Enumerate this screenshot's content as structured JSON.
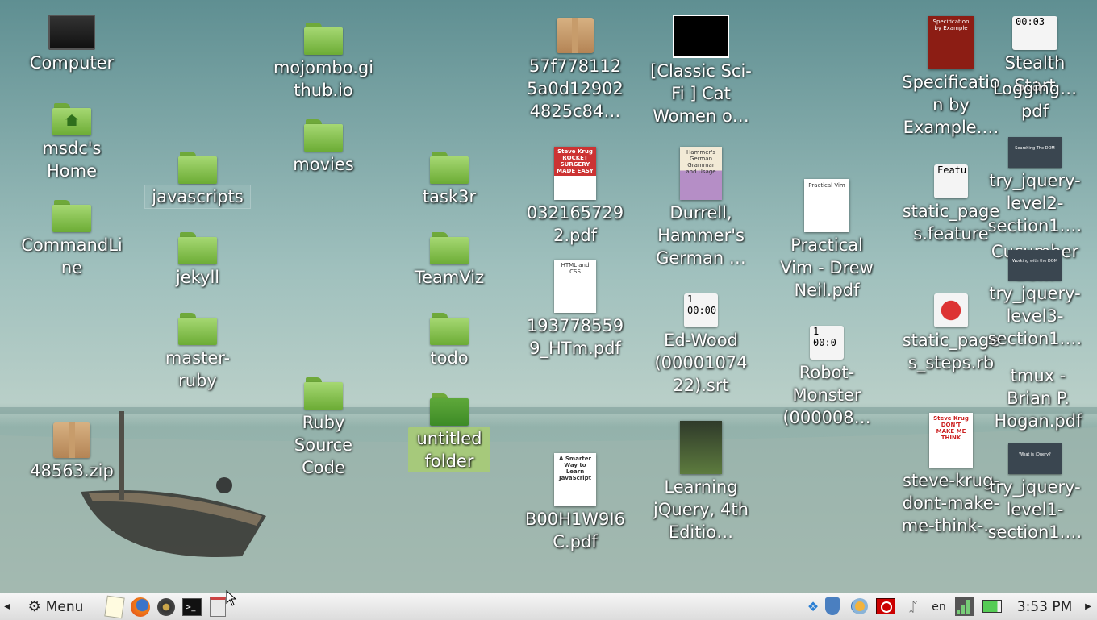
{
  "desktop": {
    "icons": {
      "computer": "Computer",
      "home": "msdc's Home",
      "commandline": "CommandLine",
      "zip48563": "48563.zip",
      "javascripts": "javascripts",
      "jekyll": "jekyll",
      "master_ruby": "master-ruby",
      "mojombo": "mojombo.github.io",
      "movies": "movies",
      "ruby_source": "Ruby Source Code",
      "task3r": "task3r",
      "teamviz": "TeamViz",
      "todo": "todo",
      "untitled": "untitled folder",
      "zip57f": "57f7781125a0d129024825c84…",
      "rocket": "0321657292.pdf",
      "html_css": "1937785599_HTm.pdf",
      "b00h": "B00H1W9I6C.pdf",
      "catwomen": "[Classic Sci-Fi ] Cat Women o…",
      "durrell": "Durrell, Hammer's German …",
      "edwood": "Ed-Wood (0000107422).srt",
      "learning_jquery": "Learning jQuery, 4th Editio…",
      "vim": "Practical Vim - Drew Neil.pdf",
      "robot": "Robot-Monster (000008…",
      "spec_example": "Specification by Example.…",
      "static_feature": "static_pages.feature",
      "static_steps": "static_pages_steps.rb",
      "dont_make": "steve-krug-dont-make-me-think-…",
      "try1": "try_jquery-level1-section1.…",
      "try2": "try_jquery-level2-section1.…",
      "try3": "try_jquery-level3-section1.…",
      "tmux": "tmux - Brian P. Hogan.pdf",
      "overlap1": "Stealth Start",
      "overlap2": "Cucumber Bo…",
      "overlap3": "Logging…pdf"
    },
    "thumbs": {
      "rocket": "Steve Krug ROCKET SURGERY MADE EASY",
      "durrell": "Hammer's German Grammar and Usage",
      "vim": "Practical Vim",
      "spec": "Specification by Example",
      "krug2": "Steve Krug DON'T MAKE ME THINK",
      "feature": "Featu",
      "srt1": "1 00:00",
      "srt2": "1 00:0",
      "srt3": "00:03",
      "slide_dom": "Searching The DOM",
      "slide_work": "Working with the DOM",
      "slide_what": "What is jQuery?",
      "smarter": "A Smarter Way to Learn JavaScript",
      "html_css": "HTML and CSS"
    }
  },
  "taskbar": {
    "menu_label": "Menu",
    "keyboard_layout": "en",
    "clock": "3:53 PM"
  }
}
